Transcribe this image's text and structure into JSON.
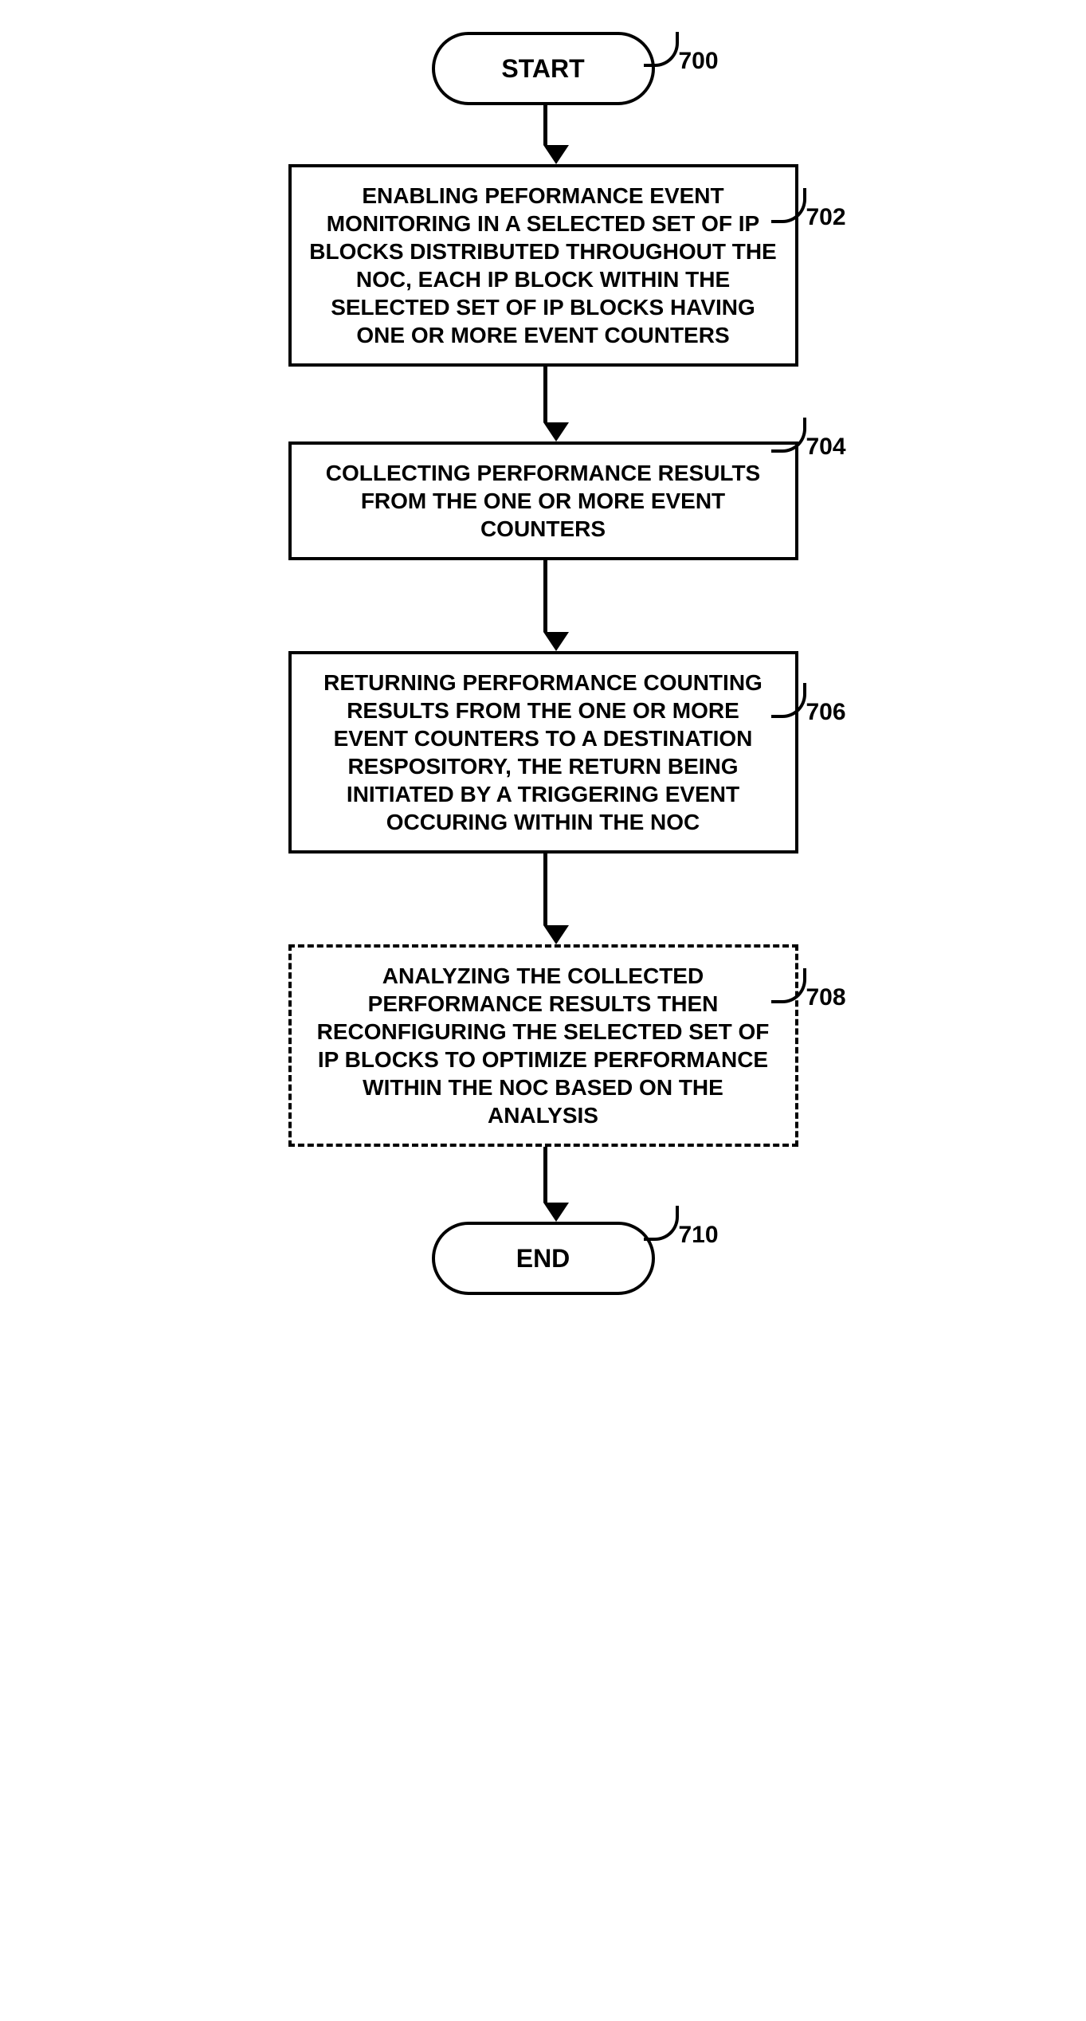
{
  "chart_data": {
    "type": "flowchart",
    "nodes": [
      {
        "id": "700",
        "type": "terminator",
        "text": "START",
        "dashed": false
      },
      {
        "id": "702",
        "type": "process",
        "text": "ENABLING PEFORMANCE EVENT MONITORING IN A SELECTED SET OF IP BLOCKS DISTRIBUTED THROUGHOUT THE NOC, EACH IP BLOCK WITHIN THE SELECTED SET OF IP BLOCKS HAVING ONE OR MORE EVENT COUNTERS",
        "dashed": false
      },
      {
        "id": "704",
        "type": "process",
        "text": "COLLECTING PERFORMANCE RESULTS FROM THE ONE OR MORE EVENT COUNTERS",
        "dashed": false
      },
      {
        "id": "706",
        "type": "process",
        "text": "RETURNING PERFORMANCE COUNTING RESULTS FROM THE ONE OR MORE EVENT COUNTERS TO A DESTINATION RESPOSITORY, THE RETURN BEING INITIATED BY A TRIGGERING EVENT OCCURING WITHIN THE NOC",
        "dashed": false
      },
      {
        "id": "708",
        "type": "process",
        "text": "ANALYZING THE COLLECTED PERFORMANCE RESULTS THEN RECONFIGURING THE SELECTED SET OF IP BLOCKS TO OPTIMIZE PERFORMANCE WITHIN THE NOC BASED ON THE ANALYSIS",
        "dashed": true
      },
      {
        "id": "710",
        "type": "terminator",
        "text": "END",
        "dashed": false
      }
    ],
    "edges": [
      [
        "700",
        "702"
      ],
      [
        "702",
        "704"
      ],
      [
        "704",
        "706"
      ],
      [
        "706",
        "708"
      ],
      [
        "708",
        "710"
      ]
    ]
  },
  "labels": {
    "n700": "700",
    "n702": "702",
    "n704": "704",
    "n706": "706",
    "n708": "708",
    "n710": "710"
  },
  "text": {
    "start": "START",
    "end": "END",
    "step702": "ENABLING PEFORMANCE EVENT MONITORING IN A SELECTED SET OF IP BLOCKS DISTRIBUTED THROUGHOUT THE NOC, EACH IP BLOCK WITHIN THE SELECTED SET OF IP BLOCKS HAVING ONE OR MORE EVENT COUNTERS",
    "step704": "COLLECTING PERFORMANCE RESULTS FROM THE ONE OR MORE EVENT COUNTERS",
    "step706": "RETURNING PERFORMANCE COUNTING RESULTS FROM THE ONE OR MORE EVENT COUNTERS TO A DESTINATION RESPOSITORY, THE RETURN BEING INITIATED BY A TRIGGERING EVENT OCCURING WITHIN THE NOC",
    "step708": "ANALYZING THE COLLECTED PERFORMANCE RESULTS THEN RECONFIGURING THE SELECTED SET OF IP BLOCKS TO OPTIMIZE PERFORMANCE WITHIN THE NOC BASED ON THE ANALYSIS"
  }
}
